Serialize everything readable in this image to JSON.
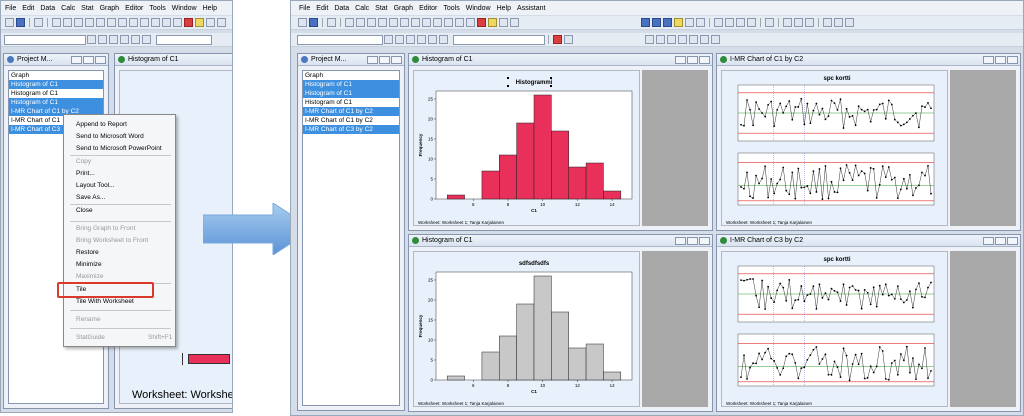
{
  "left": {
    "menu": [
      "File",
      "Edit",
      "Data",
      "Calc",
      "Stat",
      "Graph",
      "Editor",
      "Tools",
      "Window",
      "Help"
    ],
    "project_title": "Project M...",
    "project_header": "Graph",
    "project_items": [
      {
        "label": "Histogram of C1",
        "selected": true
      },
      {
        "label": "Histogram of C1",
        "selected": false
      },
      {
        "label": "Histogram of C1",
        "selected": true
      },
      {
        "label": "I-MR Chart of C1 by C2",
        "selected": true
      },
      {
        "label": "I-MR Chart of C1",
        "selected": false
      },
      {
        "label": "I-MR Chart of C3",
        "selected": true
      }
    ],
    "graph_title": "Histogram of C1",
    "worksheet_text": "Worksheet: Workshe",
    "context_menu": [
      {
        "label": "Append to Report",
        "disabled": false
      },
      {
        "label": "Send to Microsoft Word",
        "disabled": false
      },
      {
        "label": "Send to Microsoft PowerPoint",
        "disabled": false
      },
      {
        "label": "Copy",
        "disabled": true
      },
      {
        "label": "Print...",
        "disabled": false
      },
      {
        "label": "Layout Tool...",
        "disabled": false
      },
      {
        "label": "Save As...",
        "disabled": false
      },
      {
        "label": "Close",
        "disabled": false
      },
      {
        "label": "Bring Graph to Front",
        "disabled": true
      },
      {
        "label": "Bring Worksheet to Front",
        "disabled": true
      },
      {
        "label": "Restore",
        "disabled": false
      },
      {
        "label": "Minimize",
        "disabled": false
      },
      {
        "label": "Maximize",
        "disabled": true
      },
      {
        "label": "Tile",
        "disabled": false
      },
      {
        "label": "Tile With Worksheet",
        "disabled": false
      },
      {
        "label": "Rename",
        "disabled": true
      },
      {
        "label": "StatGuide",
        "shortcut": "Shift+F1",
        "disabled": true
      }
    ],
    "highlight_color": "#d93a2b"
  },
  "right": {
    "menu": [
      "File",
      "Edit",
      "Data",
      "Calc",
      "Stat",
      "Graph",
      "Editor",
      "Tools",
      "Window",
      "Help",
      "Assistant"
    ],
    "project_title": "Project M...",
    "project_header": "Graph",
    "project_items": [
      {
        "label": "Histogram of C1",
        "selected": true
      },
      {
        "label": "Histogram of C1",
        "selected": true
      },
      {
        "label": "Histogram of C1",
        "selected": false
      },
      {
        "label": "I-MR Chart of C1 by C2",
        "selected": true
      },
      {
        "label": "I-MR Chart of C1 by C2",
        "selected": false
      },
      {
        "label": "I-MR Chart of C3 by C2",
        "selected": true
      }
    ],
    "windows": {
      "hist1": {
        "title": "Histogram of C1",
        "graph_title": "Histogrammi",
        "bar_color": "#e8305a",
        "ylabel": "Frequency",
        "xlabel": "C1",
        "worksheet": "Worksheet: Worksheet 1; Tanja Karjalainen"
      },
      "hist2": {
        "title": "Histogram of C1",
        "graph_title": "sdfsdfsdfs",
        "bar_color": "#c8c8c8",
        "ylabel": "Frequency",
        "xlabel": "C1",
        "worksheet": "Worksheet: Worksheet 1; Tanja Karjalainen"
      },
      "imr1": {
        "title": "I-MR Chart of C1 by C2",
        "graph_title": "spc kortti",
        "worksheet": "Worksheet: Worksheet 1; Tanja Karjalainen"
      },
      "imr2": {
        "title": "I-MR Chart of C3 by C2",
        "graph_title": "spc kortti",
        "worksheet": "Worksheet: Worksheet 1; Tanja Karjalainen"
      }
    }
  },
  "chart_data": [
    {
      "type": "bar",
      "title": "Histogrammi",
      "xlabel": "C1",
      "ylabel": "Frequency",
      "x": [
        5,
        6,
        7,
        8,
        9,
        10,
        11,
        12,
        13,
        14
      ],
      "values": [
        1,
        0,
        7,
        11,
        19,
        26,
        17,
        8,
        9,
        2
      ],
      "ylim": [
        0,
        27
      ],
      "xticks": [
        6,
        8,
        10,
        12,
        14
      ],
      "yticks": [
        0,
        5,
        10,
        15,
        20,
        25
      ]
    },
    {
      "type": "bar",
      "title": "sdfsdfsdfs",
      "xlabel": "C1",
      "ylabel": "Frequency",
      "x": [
        5,
        6,
        7,
        8,
        9,
        10,
        11,
        12,
        13,
        14
      ],
      "values": [
        1,
        0,
        7,
        11,
        19,
        26,
        17,
        8,
        9,
        2
      ],
      "ylim": [
        0,
        27
      ],
      "xticks": [
        6,
        8,
        10,
        12,
        14
      ],
      "yticks": [
        0,
        5,
        10,
        15,
        20,
        25
      ]
    }
  ]
}
